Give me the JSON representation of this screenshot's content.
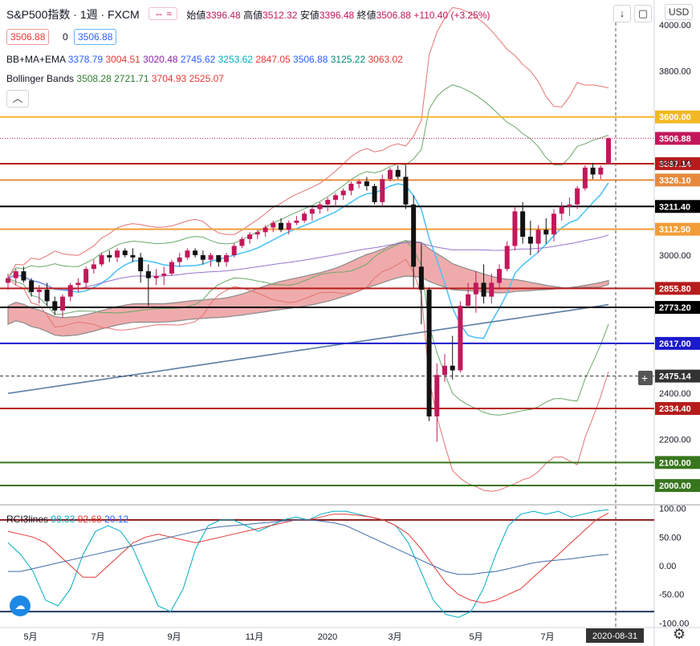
{
  "header": {
    "symbol": "S&P500指数 · 1週 · FXCM",
    "ohlc_labels": [
      "始値",
      "高値",
      "安値",
      "終値"
    ],
    "open": "3396.48",
    "high": "3512.32",
    "low": "3396.48",
    "close": "3506.88",
    "change": "+110.40 (+3.25%)",
    "price_sell": "3506.88",
    "spread": "0",
    "price_buy": "3506.88",
    "currency": "USD"
  },
  "indicators": [
    {
      "name": "BB+MA+EMA",
      "values": [
        "3378.79",
        "3004.51",
        "3020.48",
        "2745.62",
        "3253.62",
        "2847.05",
        "3506.88",
        "3125.22",
        "3063.02"
      ],
      "colors": [
        "#2962ff",
        "#e53935",
        "#8e24aa",
        "#2962ff",
        "#00acc1",
        "#e53935",
        "#2962ff",
        "#00897b",
        "#e53935"
      ]
    },
    {
      "name": "Bollinger Bands",
      "values": [
        "3508.28",
        "2721.71",
        "3704.93",
        "2525.07"
      ],
      "colors": [
        "#2e7d32",
        "#2e7d32",
        "#e53935",
        "#e53935"
      ]
    }
  ],
  "rci_panel": {
    "name": "RCI3lines",
    "values": [
      "98.33",
      "92.68",
      "20.12"
    ],
    "colors": [
      "#00acc1",
      "#e53935",
      "#2962ff"
    ]
  },
  "chart_data": {
    "type": "candlestick",
    "timeframe": "weekly",
    "price_axis": {
      "ticks": [
        "4000.00",
        "3800.00",
        "3400.00",
        "3000.00",
        "2400.00",
        "2200.00"
      ],
      "range": [
        1920,
        4010
      ]
    },
    "time_axis": {
      "ticks": [
        "5月",
        "7月",
        "9月",
        "11月",
        "2020",
        "3月",
        "5月",
        "7月"
      ],
      "current": "2020-08-31"
    },
    "horizontal_levels": [
      {
        "value": 3600.0,
        "label": "3600.00",
        "color": "#f2b824"
      },
      {
        "value": 3506.88,
        "label": "3506.88",
        "color": "#c2185b",
        "kind": "last_price"
      },
      {
        "value": 3397.14,
        "label": "3397.14",
        "color": "#b71c1c"
      },
      {
        "value": 3326.1,
        "label": "3326.10",
        "color": "#e68a3d"
      },
      {
        "value": 3211.4,
        "label": "3211.40",
        "color": "#000000"
      },
      {
        "value": 3112.5,
        "label": "3112.50",
        "color": "#f29d38"
      },
      {
        "value": 2855.8,
        "label": "2855.80",
        "color": "#b71c1c"
      },
      {
        "value": 2773.2,
        "label": "2773.20",
        "color": "#000000"
      },
      {
        "value": 2617.0,
        "label": "2617.00",
        "color": "#1a1acc"
      },
      {
        "value": 2475.14,
        "label": "2475.14",
        "color": "#333333",
        "kind": "crosshair"
      },
      {
        "value": 2334.4,
        "label": "2334.40",
        "color": "#b71c1c"
      },
      {
        "value": 2100.0,
        "label": "2100.00",
        "color": "#38761d"
      },
      {
        "value": 2000.0,
        "label": "2000.00",
        "color": "#38761d"
      }
    ],
    "candles": [
      [
        2880,
        2920,
        2850,
        2900
      ],
      [
        2900,
        2940,
        2870,
        2930
      ],
      [
        2930,
        2950,
        2880,
        2890
      ],
      [
        2890,
        2900,
        2820,
        2840
      ],
      [
        2840,
        2870,
        2790,
        2850
      ],
      [
        2850,
        2880,
        2780,
        2800
      ],
      [
        2800,
        2820,
        2740,
        2760
      ],
      [
        2760,
        2830,
        2730,
        2820
      ],
      [
        2820,
        2880,
        2800,
        2870
      ],
      [
        2870,
        2900,
        2840,
        2880
      ],
      [
        2880,
        2950,
        2860,
        2940
      ],
      [
        2940,
        2980,
        2920,
        2960
      ],
      [
        2960,
        3010,
        2950,
        3000
      ],
      [
        3000,
        3020,
        2970,
        2990
      ],
      [
        2990,
        3030,
        2970,
        3020
      ],
      [
        3020,
        3030,
        2990,
        3000
      ],
      [
        3000,
        3030,
        2970,
        2990
      ],
      [
        2990,
        3010,
        2880,
        2930
      ],
      [
        2930,
        2960,
        2780,
        2900
      ],
      [
        2900,
        2940,
        2870,
        2910
      ],
      [
        2910,
        2950,
        2870,
        2920
      ],
      [
        2920,
        2980,
        2910,
        2970
      ],
      [
        2970,
        3010,
        2950,
        2990
      ],
      [
        2990,
        3030,
        2980,
        3020
      ],
      [
        3020,
        3030,
        2990,
        3000
      ],
      [
        3000,
        3020,
        2960,
        2980
      ],
      [
        2980,
        3010,
        2950,
        3000
      ],
      [
        3000,
        3000,
        2950,
        2970
      ],
      [
        2970,
        3010,
        2950,
        3000
      ],
      [
        3000,
        3050,
        2990,
        3040
      ],
      [
        3040,
        3080,
        3030,
        3070
      ],
      [
        3070,
        3100,
        3050,
        3090
      ],
      [
        3090,
        3110,
        3070,
        3100
      ],
      [
        3100,
        3130,
        3080,
        3120
      ],
      [
        3120,
        3150,
        3100,
        3140
      ],
      [
        3140,
        3160,
        3100,
        3110
      ],
      [
        3110,
        3150,
        3090,
        3140
      ],
      [
        3140,
        3170,
        3130,
        3150
      ],
      [
        3150,
        3190,
        3140,
        3180
      ],
      [
        3180,
        3210,
        3150,
        3200
      ],
      [
        3200,
        3230,
        3180,
        3220
      ],
      [
        3220,
        3250,
        3190,
        3240
      ],
      [
        3240,
        3270,
        3210,
        3260
      ],
      [
        3260,
        3290,
        3240,
        3280
      ],
      [
        3280,
        3320,
        3260,
        3310
      ],
      [
        3310,
        3330,
        3290,
        3320
      ],
      [
        3320,
        3340,
        3280,
        3300
      ],
      [
        3300,
        3310,
        3220,
        3230
      ],
      [
        3230,
        3350,
        3210,
        3330
      ],
      [
        3330,
        3380,
        3320,
        3370
      ],
      [
        3370,
        3390,
        3330,
        3340
      ],
      [
        3340,
        3390,
        3200,
        3220
      ],
      [
        3220,
        3260,
        2860,
        2950
      ],
      [
        2950,
        3050,
        2700,
        2850
      ],
      [
        2850,
        2860,
        2280,
        2300
      ],
      [
        2300,
        2530,
        2190,
        2480
      ],
      [
        2480,
        2570,
        2450,
        2520
      ],
      [
        2520,
        2650,
        2460,
        2500
      ],
      [
        2500,
        2800,
        2490,
        2780
      ],
      [
        2780,
        2880,
        2770,
        2830
      ],
      [
        2830,
        2930,
        2750,
        2880
      ],
      [
        2880,
        2960,
        2790,
        2820
      ],
      [
        2820,
        2920,
        2790,
        2880
      ],
      [
        2880,
        2960,
        2850,
        2940
      ],
      [
        2940,
        3060,
        2930,
        3040
      ],
      [
        3040,
        3210,
        3020,
        3190
      ],
      [
        3190,
        3230,
        3050,
        3080
      ],
      [
        3080,
        3150,
        3000,
        3050
      ],
      [
        3050,
        3130,
        3010,
        3110
      ],
      [
        3110,
        3160,
        3050,
        3090
      ],
      [
        3090,
        3200,
        3060,
        3180
      ],
      [
        3180,
        3230,
        3150,
        3210
      ],
      [
        3210,
        3250,
        3170,
        3220
      ],
      [
        3220,
        3300,
        3200,
        3290
      ],
      [
        3290,
        3390,
        3280,
        3380
      ],
      [
        3380,
        3400,
        3330,
        3350
      ],
      [
        3350,
        3390,
        3330,
        3380
      ],
      [
        3396.48,
        3512.32,
        3396.48,
        3506.88
      ]
    ],
    "rci_axis": {
      "ticks": [
        "100.00",
        "50.00",
        "0.00",
        "-50.00",
        "-100.00"
      ],
      "range": [
        -105,
        105
      ]
    },
    "rci_levels": [
      {
        "value": 80,
        "color": "#8b1a1a"
      },
      {
        "value": -80,
        "color": "#1f3a5f"
      }
    ],
    "rci_series": [
      {
        "name": "short",
        "color": "#00acc1",
        "values": [
          40,
          20,
          -10,
          -60,
          -70,
          -40,
          20,
          60,
          70,
          60,
          30,
          -20,
          -70,
          -80,
          -40,
          30,
          70,
          80,
          80,
          70,
          60,
          70,
          80,
          85,
          80,
          90,
          95,
          95,
          90,
          85,
          80,
          70,
          40,
          -10,
          -60,
          -85,
          -90,
          -80,
          -40,
          20,
          70,
          90,
          95,
          90,
          95,
          85,
          90,
          95,
          98
        ]
      },
      {
        "name": "mid",
        "color": "#e53935",
        "values": [
          60,
          55,
          50,
          40,
          20,
          0,
          -20,
          -20,
          0,
          20,
          40,
          50,
          55,
          50,
          45,
          40,
          45,
          50,
          55,
          60,
          65,
          70,
          75,
          80,
          80,
          85,
          90,
          90,
          88,
          85,
          80,
          70,
          55,
          30,
          0,
          -30,
          -50,
          -60,
          -65,
          -60,
          -50,
          -40,
          -20,
          0,
          20,
          40,
          60,
          80,
          92
        ]
      },
      {
        "name": "long",
        "color": "#3f6aa8",
        "values": [
          -10,
          -10,
          -5,
          0,
          5,
          10,
          15,
          20,
          25,
          30,
          35,
          40,
          45,
          50,
          55,
          60,
          65,
          68,
          70,
          72,
          74,
          76,
          78,
          80,
          80,
          78,
          75,
          70,
          60,
          50,
          40,
          30,
          20,
          10,
          0,
          -10,
          -15,
          -15,
          -12,
          -10,
          -5,
          0,
          5,
          8,
          10,
          12,
          15,
          18,
          20
        ]
      }
    ]
  }
}
